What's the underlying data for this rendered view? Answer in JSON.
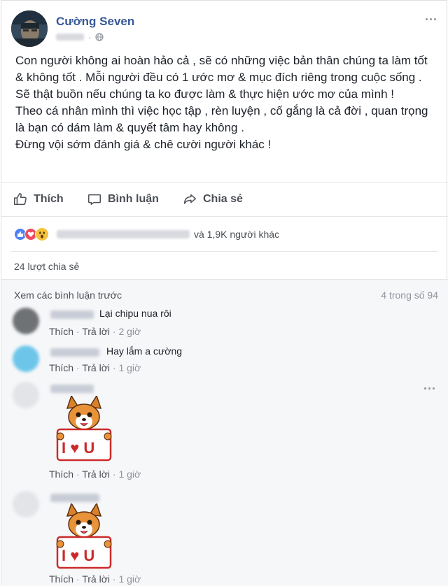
{
  "post": {
    "author": "Cường Seven",
    "body": [
      "Con người không ai hoàn hảo cả , sẽ có những việc bản thân chúng ta làm tốt & không tốt . Mỗi người đều có 1 ước mơ & mục đích riêng trong cuộc sống . Sẽ thật buồn nếu chúng ta ko được làm & thực hiện ước mơ của mình !",
      "Theo cá nhân mình thì việc học tập , rèn luyện , cố gắng là cả đời , quan trọng là bạn có dám làm & quyết tâm hay không .",
      "Đừng vội sớm đánh giá & chê cười người khác !"
    ]
  },
  "actions": {
    "like": "Thích",
    "comment": "Bình luận",
    "share": "Chia sẻ"
  },
  "reactions": {
    "others": "và 1,9K người khác"
  },
  "shares": "24 lượt chia sẻ",
  "comments": {
    "prev_label": "Xem các bình luận trước",
    "counter": "4 trong số 94",
    "items": [
      {
        "text": "Lại chipu nua rôi",
        "like": "Thích",
        "reply": "Trả lời",
        "time": "2 giờ"
      },
      {
        "text": "Hay lắm a cường",
        "like": "Thích",
        "reply": "Trả lời",
        "time": "1 giờ"
      },
      {
        "sticker_text": "I ♥ U",
        "like": "Thích",
        "reply": "Trả lời",
        "time": "1 giờ"
      },
      {
        "sticker_text": "I ♥ U",
        "like": "Thích",
        "reply": "Trả lời",
        "time": "1 giờ"
      }
    ]
  },
  "colors": {
    "link": "#365899",
    "like_blue": "#4e80f7",
    "love_red": "#f04a5f",
    "wow_yellow": "#f7c33b"
  }
}
